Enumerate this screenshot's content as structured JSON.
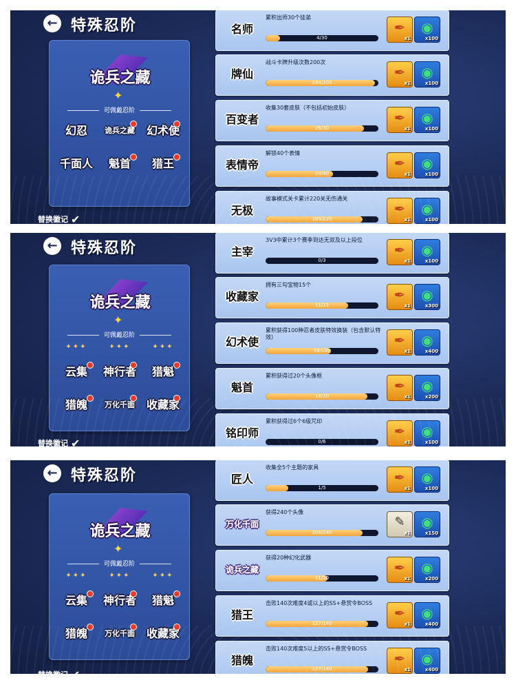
{
  "page_title": "特殊忍阶",
  "emblem_text": "诡兵之藏",
  "ranks_header": "可佩戴忍阶",
  "swap_label": "替换徽记",
  "panels": [
    {
      "rank_rows": [
        [
          {
            "label": "幻忍",
            "dot": false
          },
          {
            "label": "诡兵之藏",
            "dot": true
          },
          {
            "label": "幻术使",
            "dot": true
          }
        ],
        [
          {
            "label": "千面人",
            "dot": false
          },
          {
            "label": "魁首",
            "dot": true
          },
          {
            "label": "猎王",
            "dot": true
          }
        ]
      ],
      "stub_row": false,
      "cards": [
        {
          "badge": "名师",
          "desc": "累积出师30个徒弟",
          "progress": "4/30",
          "fraction": 0.13,
          "r1_qty": "x1",
          "r2_qty": "x100"
        },
        {
          "badge": "牌仙",
          "desc": "战斗卡牌升级次数200次",
          "progress": "194/200",
          "fraction": 0.97,
          "r1_qty": "x1",
          "r2_qty": "x100"
        },
        {
          "badge": "百变者",
          "desc": "收集30套皮肤（不包括初始皮肤）",
          "progress": "26/30",
          "fraction": 0.87,
          "r1_qty": "x1",
          "r2_qty": "x100"
        },
        {
          "badge": "表情帝",
          "desc": "解锁40个表情",
          "progress": "24/40",
          "fraction": 0.6,
          "r1_qty": "x1",
          "r2_qty": "x100"
        },
        {
          "badge": "无极",
          "desc": "故事模式关卡累计220关无伤通关",
          "progress": "189/220",
          "fraction": 0.86,
          "r1_qty": "x1",
          "r2_qty": "x100"
        }
      ]
    },
    {
      "rank_rows": [
        [
          {
            "label": "云集",
            "dot": true
          },
          {
            "label": "神行者",
            "dot": true
          },
          {
            "label": "猎魁",
            "dot": true
          }
        ],
        [
          {
            "label": "猎魄",
            "dot": true
          },
          {
            "label": "万化千面",
            "dot": true
          },
          {
            "label": "收藏家",
            "dot": true
          }
        ]
      ],
      "stub_row": true,
      "cards": [
        {
          "badge": "主宰",
          "desc": "3V3中累计3个赛季到达无双及以上段位",
          "progress": "0/3",
          "fraction": 0.0,
          "r1_qty": "x1",
          "r2_qty": "x100"
        },
        {
          "badge": "收藏家",
          "desc": "拥有三勾宝物15个",
          "progress": "11/15",
          "fraction": 0.73,
          "r1_qty": "x1",
          "r2_qty": "x300"
        },
        {
          "badge": "幻术使",
          "desc": "累积获得100种忍者皮肤特效换装（包含默认特效）",
          "progress": "58/100",
          "fraction": 0.58,
          "r1_qty": "x1",
          "r2_qty": "x400"
        },
        {
          "badge": "魁首",
          "desc": "累积获得过20个头像框",
          "progress": "18/20",
          "fraction": 0.9,
          "r1_qty": "x1",
          "r2_qty": "x200"
        },
        {
          "badge": "铭印师",
          "desc": "累积获得过6个6级咒印",
          "progress": "0/6",
          "fraction": 0.0,
          "r1_qty": "x1",
          "r2_qty": "x100"
        }
      ]
    },
    {
      "rank_rows": [
        [
          {
            "label": "云集",
            "dot": true
          },
          {
            "label": "神行者",
            "dot": true
          },
          {
            "label": "猎魁",
            "dot": true
          }
        ],
        [
          {
            "label": "猎魄",
            "dot": true
          },
          {
            "label": "万化千面",
            "dot": true
          },
          {
            "label": "收藏家",
            "dot": true
          }
        ]
      ],
      "stub_row": true,
      "cards": [
        {
          "badge": "匠人",
          "desc": "收集全5个主题的家具",
          "progress": "1/5",
          "fraction": 0.2,
          "r1_qty": "x1",
          "r2_qty": "x100"
        },
        {
          "badge": "万化千面",
          "desc": "获得240个头像",
          "progress": "206/240",
          "fraction": 0.86,
          "r1_qty": "x1",
          "r2_qty": "x150",
          "r1_paper": true
        },
        {
          "badge": "诡兵之藏",
          "desc": "获得20种幻化武器",
          "progress": "11/20",
          "fraction": 0.55,
          "r1_qty": "x1",
          "r2_qty": "x200"
        },
        {
          "badge": "猎王",
          "desc": "击败140次难度4或以上的SS+悬赏令BOSS",
          "progress": "127/140",
          "fraction": 0.91,
          "r1_qty": "x1",
          "r2_qty": "x400"
        },
        {
          "badge": "猎魄",
          "desc": "击败140次难度5以上的SS+悬赏令BOSS",
          "progress": "127/140",
          "fraction": 0.91,
          "r1_qty": "x1",
          "r2_qty": "x400"
        }
      ]
    }
  ]
}
